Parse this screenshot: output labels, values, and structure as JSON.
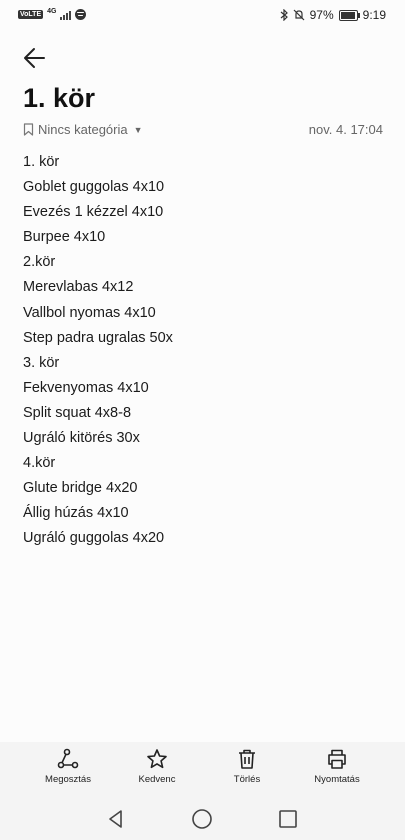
{
  "status_bar": {
    "volte": "VoLTE",
    "network": "4G",
    "battery": "97%",
    "time": "9:19"
  },
  "header": {
    "back_icon": "arrow-left-icon"
  },
  "note": {
    "title": "1. kör",
    "category": "Nincs kategória",
    "timestamp": "nov. 4. 17:04",
    "lines": [
      "1. kör",
      "Goblet guggolas 4x10",
      "Evezés 1 kézzel 4x10",
      "Burpee 4x10",
      "2.kör",
      "Merevlabas 4x12",
      "Vallbol nyomas 4x10",
      "Step padra ugralas 50x",
      "3. kör",
      "Fekvenyomas 4x10",
      "Split squat 4x8-8",
      "Ugráló kitörés 30x",
      "4.kör",
      "Glute bridge 4x20",
      "Állig húzás 4x10",
      "Ugráló guggolas 4x20"
    ]
  },
  "toolbar": {
    "share": "Megosztás",
    "favorite": "Kedvenc",
    "delete": "Törlés",
    "print": "Nyomtatás"
  }
}
